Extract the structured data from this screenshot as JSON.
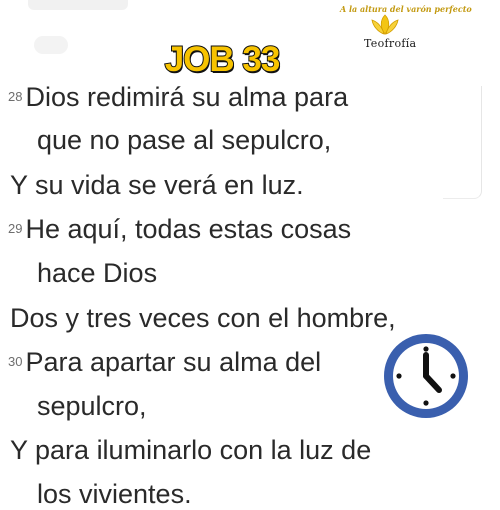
{
  "header": {
    "book_title": "JOB 33"
  },
  "logo": {
    "tagline": "A la altura del varón perfecto",
    "name": "Teofrofía",
    "icon": "lotus-flower-icon"
  },
  "passage": {
    "lines": [
      {
        "verse": "28",
        "text": "Dios redimirá su alma para"
      },
      {
        "verse": "",
        "text": "que no pase al sepulcro,"
      },
      {
        "verse": "",
        "text": "Y su vida se verá en luz."
      },
      {
        "verse": "29",
        "text": "He aquí, todas estas cosas"
      },
      {
        "verse": "",
        "text": "hace Dios"
      },
      {
        "verse": "",
        "text": "Dos y tres veces con el hombre,"
      },
      {
        "verse": "30",
        "text": "Para apartar su alma del"
      },
      {
        "verse": "",
        "text": "sepulcro,"
      },
      {
        "verse": "",
        "text": "Y para iluminarlo con la luz de"
      },
      {
        "verse": "",
        "text": "los vivientes."
      }
    ]
  },
  "clock": {
    "icon": "clock-icon",
    "ring_color": "#3a5fae",
    "face_color": "#ffffff",
    "hand_color": "#111111"
  }
}
